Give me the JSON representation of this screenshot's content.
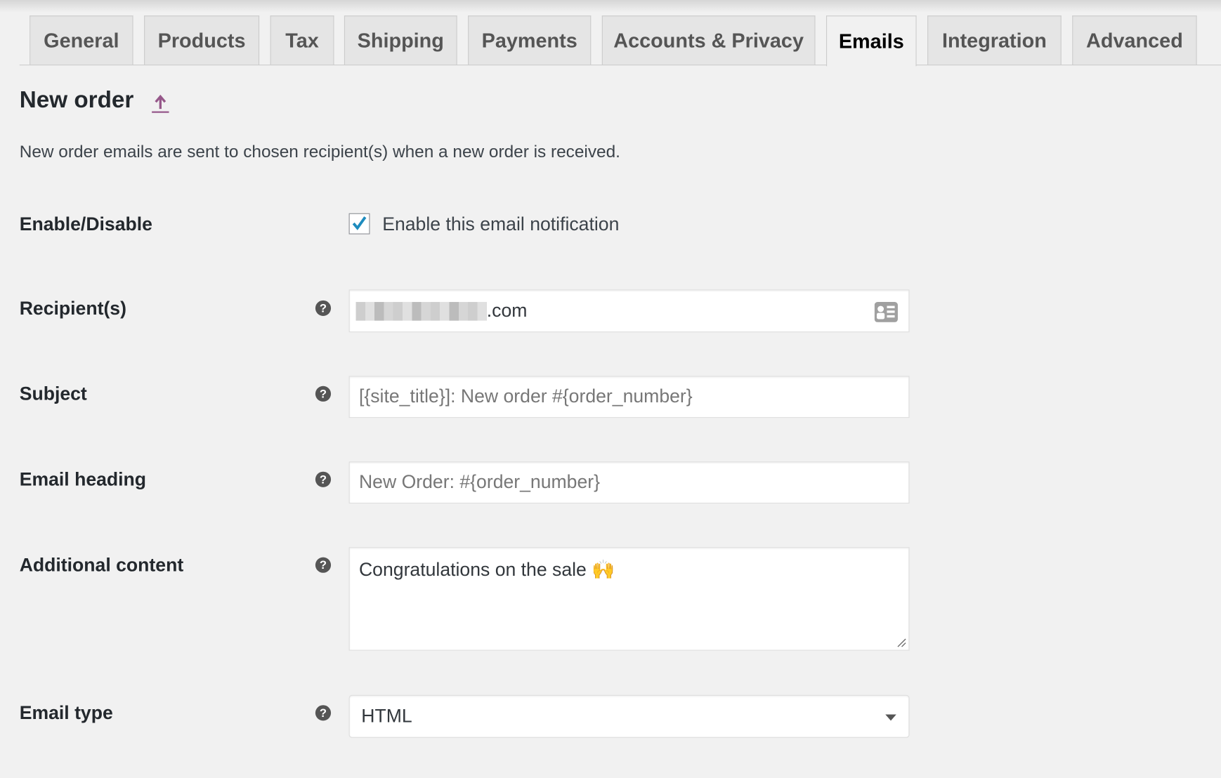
{
  "tabs": [
    {
      "label": "General",
      "active": false
    },
    {
      "label": "Products",
      "active": false
    },
    {
      "label": "Tax",
      "active": false
    },
    {
      "label": "Shipping",
      "active": false
    },
    {
      "label": "Payments",
      "active": false
    },
    {
      "label": "Accounts & Privacy",
      "active": false
    },
    {
      "label": "Emails",
      "active": true
    },
    {
      "label": "Integration",
      "active": false
    },
    {
      "label": "Advanced",
      "active": false
    }
  ],
  "section": {
    "title": "New order",
    "up_link_icon": "up-arrow-icon",
    "description": "New order emails are sent to chosen recipient(s) when a new order is received."
  },
  "fields": {
    "enable": {
      "label": "Enable/Disable",
      "checkbox_label": "Enable this email notification",
      "checked": true
    },
    "recipient": {
      "label": "Recipient(s)",
      "value_visible": ".com",
      "icon": "contact-card-icon"
    },
    "subject": {
      "label": "Subject",
      "placeholder": "[{site_title}]: New order #{order_number}"
    },
    "heading": {
      "label": "Email heading",
      "placeholder": "New Order: #{order_number}"
    },
    "additional": {
      "label": "Additional content",
      "value": "Congratulations on the sale 🙌"
    },
    "email_type": {
      "label": "Email type",
      "selected": "HTML"
    }
  },
  "help_icon": "?",
  "colors": {
    "accent": "#96588a",
    "checkmark": "#1e8cbe",
    "background": "#f1f1f1"
  }
}
